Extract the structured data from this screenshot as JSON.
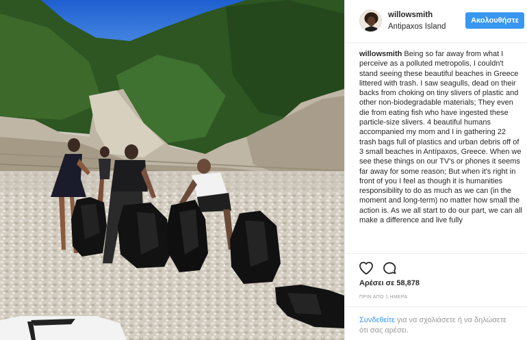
{
  "post": {
    "username": "willowsmith",
    "location": "Antipaxos Island",
    "follow_label": "Ακολουθήστε",
    "caption_user": "willowsmith",
    "caption_text": "Being so far away from what I perceive as a polluted metropolis, I couldn't stand seeing these beautiful beaches in Greece littered with trash. I saw seagulls, dead on their backs from choking on tiny slivers of plastic and other non-biodegradable materials; They even die from eating fish who have ingested these particle-size slivers. 4 beautiful humans accompanied my mom and I in gathering 22 trash bags full of plastics and urban debris off of 3 small beaches in Antípaxos, Greece. When we see these things on our TV's or phones it seems far away for some reason; But when it's right in front of you I feel as though it is humanities responsibility to do as much as we can (in the moment and long-term) no matter how small the action is. As we all start to do our part, we can all make a difference and live fully",
    "likes_label": "Αρέσει σε 58,878",
    "timestamp": "ΠΡΙΝ ΑΠΟ 1 ΗΜΕΡΑ",
    "login_link": "Συνδεθείτε",
    "comment_prompt": " για να σχολιάσετε ή να δηλώσετε ότι σας αρέσει."
  },
  "icons": {
    "like": "heart-icon",
    "comment": "comment-bubble-icon"
  },
  "colors": {
    "accent": "#3897f0",
    "text": "#262626",
    "muted": "#999999",
    "sky": "#2a6fd6",
    "forest": "#2f5a24",
    "trash_bag": "#111111"
  }
}
